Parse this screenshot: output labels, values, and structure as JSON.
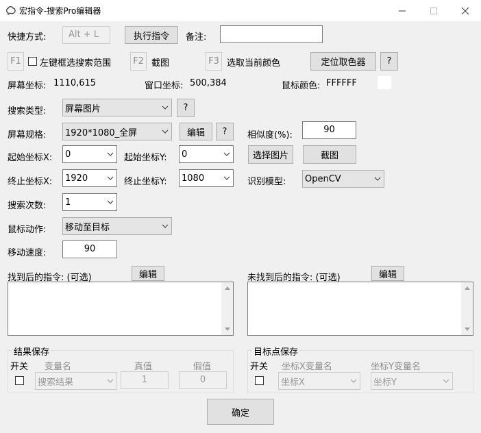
{
  "window": {
    "title": "宏指令-搜索Pro编辑器"
  },
  "hotkey": {
    "label": "快捷方式:",
    "value": "Alt + L",
    "exec_button": "执行指令",
    "note_label": "备注:",
    "note_value": ""
  },
  "fkeys": {
    "f1": "F1",
    "f1_label": "左键框选搜索范围",
    "f2": "F2",
    "f2_label": "截图",
    "f3": "F3",
    "f3_label": "选取当前颜色",
    "locate_button": "定位取色器",
    "help": "?"
  },
  "info": {
    "screen_coord_label": "屏幕坐标:",
    "screen_coord_value": "1110,615",
    "window_coord_label": "窗口坐标:",
    "window_coord_value": "500,384",
    "mouse_color_label": "鼠标颜色:",
    "mouse_color_value": "FFFFFF",
    "mouse_color_swatch": "#ffffff"
  },
  "search": {
    "type_label": "搜索类型:",
    "type_value": "屏幕图片",
    "type_help": "?",
    "spec_label": "屏幕规格:",
    "spec_value": "1920*1080_全屏",
    "edit_button": "编辑",
    "spec_help": "?",
    "similarity_label": "相似度(%):",
    "similarity_value": "90",
    "start_x_label": "起始坐标X:",
    "start_x_value": "0",
    "start_y_label": "起始坐标Y:",
    "start_y_value": "0",
    "select_image_button": "选择图片",
    "screenshot_button": "截图",
    "end_x_label": "终止坐标X:",
    "end_x_value": "1920",
    "end_y_label": "终止坐标Y:",
    "end_y_value": "1080",
    "model_label": "识别模型:",
    "model_value": "OpenCV",
    "count_label": "搜索次数:",
    "count_value": "1",
    "action_label": "鼠标动作:",
    "action_value": "移动至目标",
    "speed_label": "移动速度:",
    "speed_value": "90"
  },
  "after": {
    "found_label": "找到后的指令: (可选)",
    "found_edit": "编辑",
    "notfound_label": "未找到后的指令: (可选)",
    "notfound_edit": "编辑"
  },
  "result_save": {
    "title": "结果保存",
    "switch_col": "开关",
    "var_col": "变量名",
    "true_col": "真值",
    "false_col": "假值",
    "var_value": "搜索结果",
    "true_value": "1",
    "false_value": "0"
  },
  "target_save": {
    "title": "目标点保存",
    "switch_col": "开关",
    "x_col": "坐标X变量名",
    "y_col": "坐标Y变量名",
    "x_value": "坐标X",
    "y_value": "坐标Y"
  },
  "footer": {
    "ok_button": "确定"
  }
}
